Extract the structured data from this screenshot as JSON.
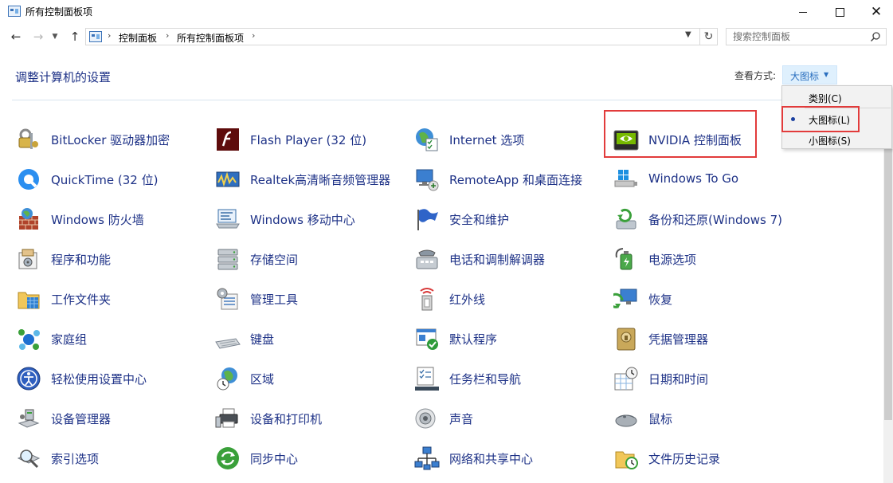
{
  "window": {
    "title": "所有控制面板项",
    "icon": "control-panel-icon"
  },
  "navigation": {
    "back_glyph": "←",
    "forward_glyph": "→",
    "recent_glyph": "⌄",
    "up_glyph": "↑",
    "breadcrumbs": [
      "控制面板",
      "所有控制面板项"
    ],
    "separator": "›",
    "dropdown_glyph": "⌄",
    "refresh_glyph": "↻",
    "search_placeholder": "搜索控制面板"
  },
  "header": {
    "title": "调整计算机的设置",
    "view_by_label": "查看方式:",
    "view_by_value": "大图标",
    "view_by_arrow": "▼"
  },
  "view_menu": {
    "items": [
      {
        "label": "类别(C)",
        "selected": false
      },
      {
        "label": "大图标(L)",
        "selected": true
      },
      {
        "label": "小图标(S)",
        "selected": false
      }
    ]
  },
  "items": [
    {
      "label": "BitLocker 驱动器加密",
      "icon": "bitlocker-icon"
    },
    {
      "label": "Flash Player (32 位)",
      "icon": "flash-player-icon"
    },
    {
      "label": "Internet 选项",
      "icon": "internet-options-icon"
    },
    {
      "label": "NVIDIA 控制面板",
      "icon": "nvidia-icon"
    },
    {
      "label": "QuickTime (32 位)",
      "icon": "quicktime-icon"
    },
    {
      "label": "Realtek高清晰音频管理器",
      "icon": "realtek-audio-icon"
    },
    {
      "label": "RemoteApp 和桌面连接",
      "icon": "remoteapp-icon"
    },
    {
      "label": "Windows To Go",
      "icon": "windows-to-go-icon"
    },
    {
      "label": "Windows 防火墙",
      "icon": "firewall-icon"
    },
    {
      "label": "Windows 移动中心",
      "icon": "mobility-center-icon"
    },
    {
      "label": "安全和维护",
      "icon": "security-maintenance-flag-icon"
    },
    {
      "label": "备份和还原(Windows 7)",
      "icon": "backup-restore-icon"
    },
    {
      "label": "程序和功能",
      "icon": "programs-features-icon"
    },
    {
      "label": "存储空间",
      "icon": "storage-spaces-icon"
    },
    {
      "label": "电话和调制解调器",
      "icon": "phone-modem-icon"
    },
    {
      "label": "电源选项",
      "icon": "power-options-icon"
    },
    {
      "label": "工作文件夹",
      "icon": "work-folders-icon"
    },
    {
      "label": "管理工具",
      "icon": "admin-tools-icon"
    },
    {
      "label": "红外线",
      "icon": "infrared-icon"
    },
    {
      "label": "恢复",
      "icon": "recovery-icon"
    },
    {
      "label": "家庭组",
      "icon": "homegroup-icon"
    },
    {
      "label": "键盘",
      "icon": "keyboard-icon"
    },
    {
      "label": "默认程序",
      "icon": "default-programs-icon"
    },
    {
      "label": "凭据管理器",
      "icon": "credential-manager-icon"
    },
    {
      "label": "轻松使用设置中心",
      "icon": "ease-of-access-icon"
    },
    {
      "label": "区域",
      "icon": "region-icon"
    },
    {
      "label": "任务栏和导航",
      "icon": "taskbar-navigation-icon"
    },
    {
      "label": "日期和时间",
      "icon": "date-time-icon"
    },
    {
      "label": "设备管理器",
      "icon": "device-manager-icon"
    },
    {
      "label": "设备和打印机",
      "icon": "devices-printers-icon"
    },
    {
      "label": "声音",
      "icon": "sound-icon"
    },
    {
      "label": "鼠标",
      "icon": "mouse-icon"
    },
    {
      "label": "索引选项",
      "icon": "indexing-options-icon"
    },
    {
      "label": "同步中心",
      "icon": "sync-center-icon"
    },
    {
      "label": "网络和共享中心",
      "icon": "network-sharing-icon"
    },
    {
      "label": "文件历史记录",
      "icon": "file-history-icon"
    }
  ],
  "colors": {
    "link": "#1e3287",
    "highlight": "#e23b3b",
    "view_value_bg": "#dff0fd"
  }
}
